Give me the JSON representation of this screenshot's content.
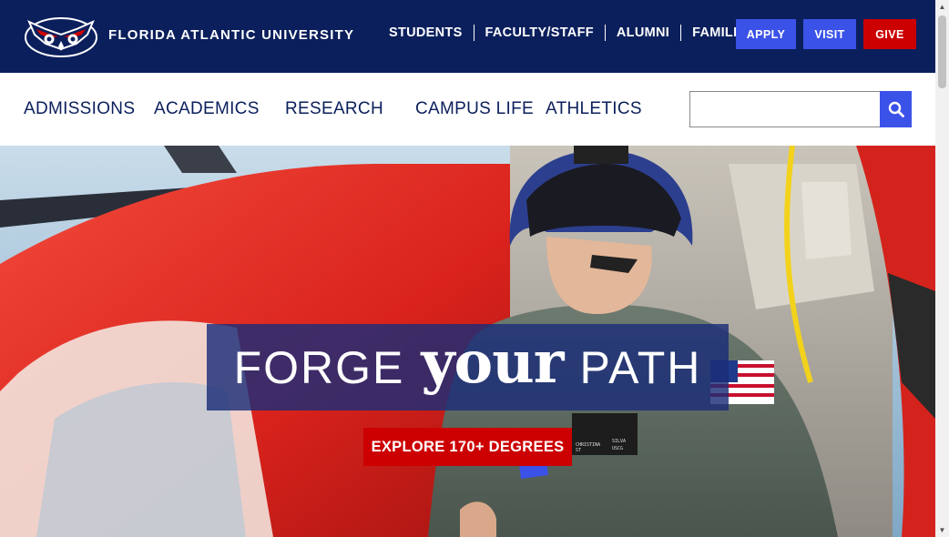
{
  "header": {
    "university_name": "FLORIDA ATLANTIC UNIVERSITY",
    "audience_links": [
      {
        "label": "STUDENTS"
      },
      {
        "label": "FACULTY/STAFF"
      },
      {
        "label": "ALUMNI"
      },
      {
        "label": "FAMILIES"
      }
    ],
    "cta": {
      "apply": "APPLY",
      "visit": "VISIT",
      "give": "GIVE"
    }
  },
  "main_nav": {
    "items": [
      {
        "label": "ADMISSIONS"
      },
      {
        "label": "ACADEMICS"
      },
      {
        "label": "RESEARCH"
      },
      {
        "label": "CAMPUS LIFE"
      },
      {
        "label": "ATHLETICS"
      }
    ],
    "search": {
      "value": "",
      "icon": "search-icon"
    }
  },
  "hero": {
    "headline_word1": "FORGE",
    "headline_word2": "your",
    "headline_word3": "PATH",
    "button_label": "EXPLORE 170+ DEGREES",
    "badge_text": {
      "name1": "CHRISTINA",
      "name2": "SILVA",
      "rank": "ST",
      "unit": "USCG"
    }
  },
  "colors": {
    "navy": "#0b1f5c",
    "blue_button": "#3b52e8",
    "red": "#cc0000"
  }
}
